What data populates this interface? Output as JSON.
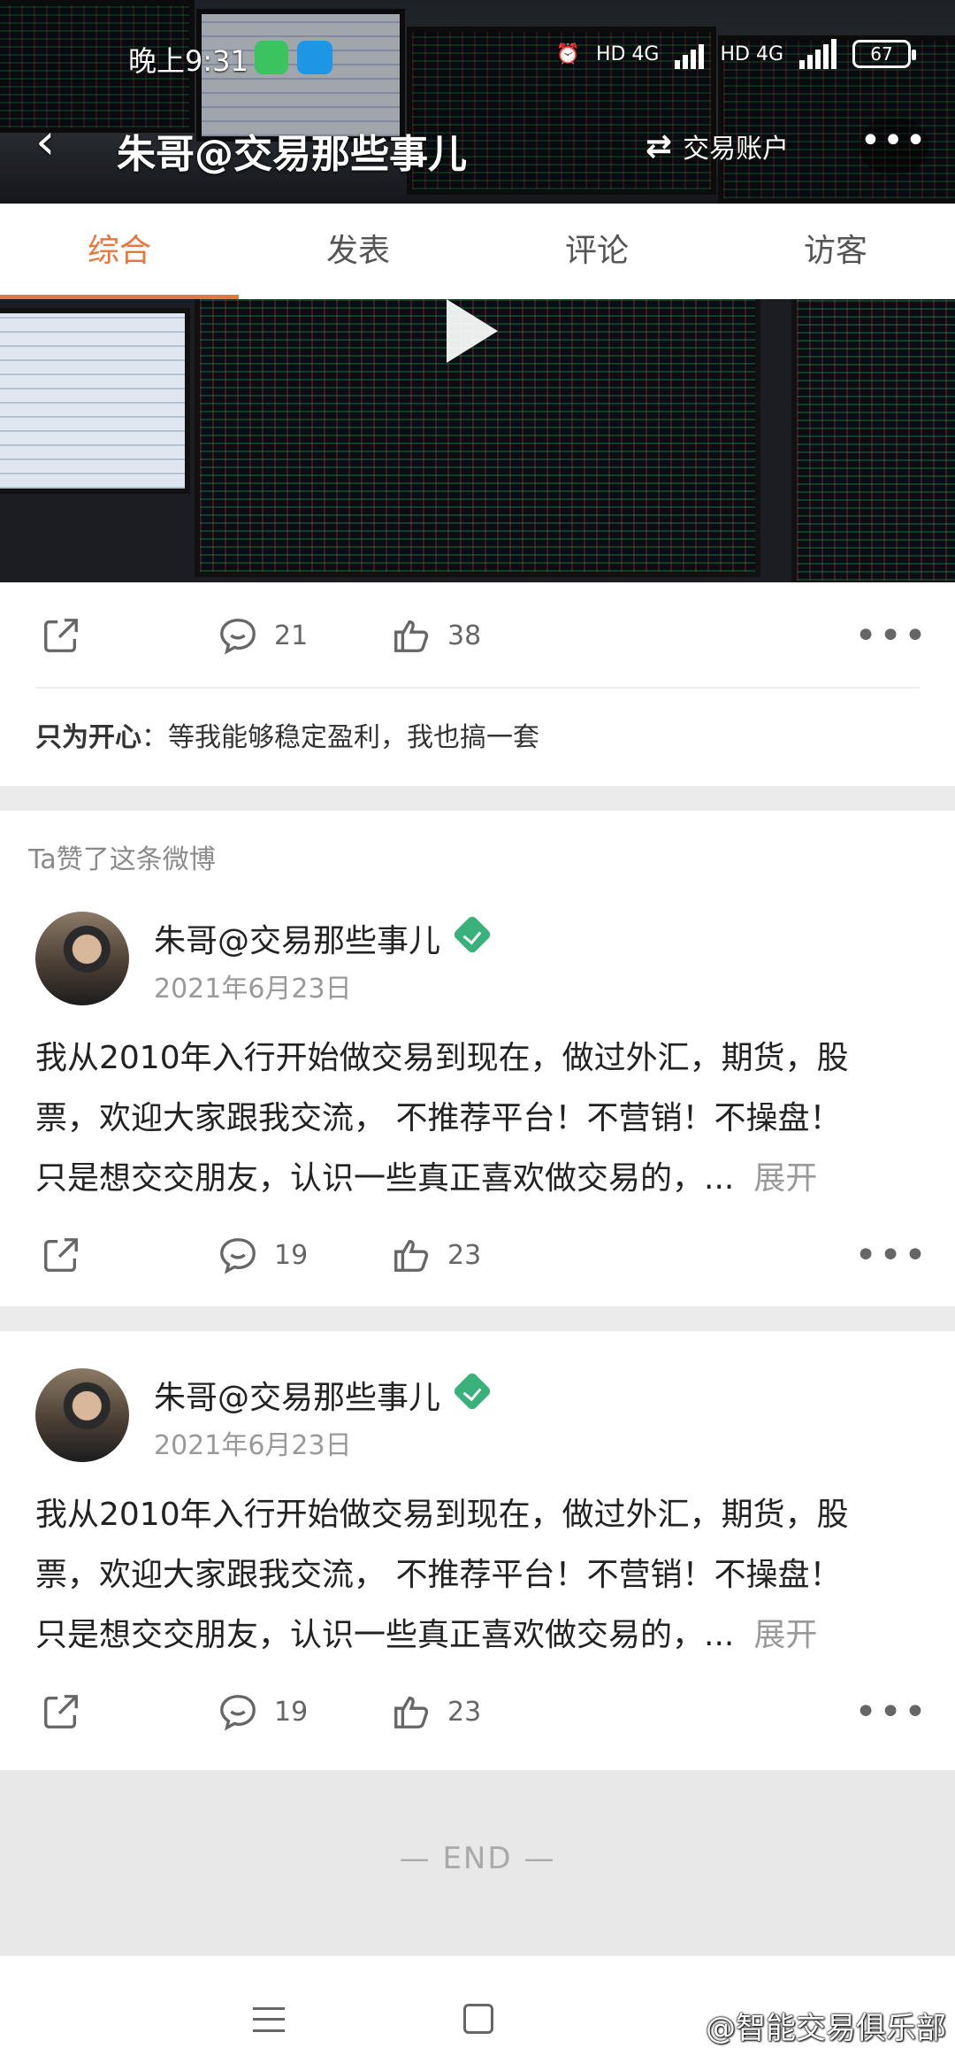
{
  "status_bar": {
    "time": "晚上9:31",
    "network_1": "HD 4G",
    "network_2": "HD 4G",
    "battery": "67"
  },
  "header": {
    "title": "朱哥@交易那些事儿",
    "account_label": "交易账户",
    "more_label": "•••"
  },
  "tabs": [
    {
      "label": "综合",
      "active": true
    },
    {
      "label": "发表",
      "active": false
    },
    {
      "label": "评论",
      "active": false
    },
    {
      "label": "访客",
      "active": false
    }
  ],
  "video_post": {
    "comments": "21",
    "likes": "38",
    "repost_author": "只为开心",
    "repost_text": "：等我能够稳定盈利，我也搞一套"
  },
  "liked_note": "Ta赞了这条微博",
  "posts": [
    {
      "author": "朱哥@交易那些事儿",
      "date": "2021年6月23日",
      "line1": "我从2010年入行开始做交易到现在，做过外汇，期货，股",
      "line2": "票，欢迎大家跟我交流， 不推荐平台！不营销！不操盘！",
      "line3": "只是想交交朋友，认识一些真正喜欢做交易的，...",
      "expand": "展开",
      "comments": "19",
      "likes": "23"
    },
    {
      "author": "朱哥@交易那些事儿",
      "date": "2021年6月23日",
      "line1": "我从2010年入行开始做交易到现在，做过外汇，期货，股",
      "line2": "票，欢迎大家跟我交流， 不推荐平台！不营销！不操盘！",
      "line3": "只是想交交朋友，认识一些真正喜欢做交易的，...",
      "expand": "展开",
      "comments": "19",
      "likes": "23"
    }
  ],
  "end_text": "— END —",
  "watermark": "@智能交易俱乐部",
  "colors": {
    "accent": "#e8773d",
    "verified": "#3ab07a"
  }
}
